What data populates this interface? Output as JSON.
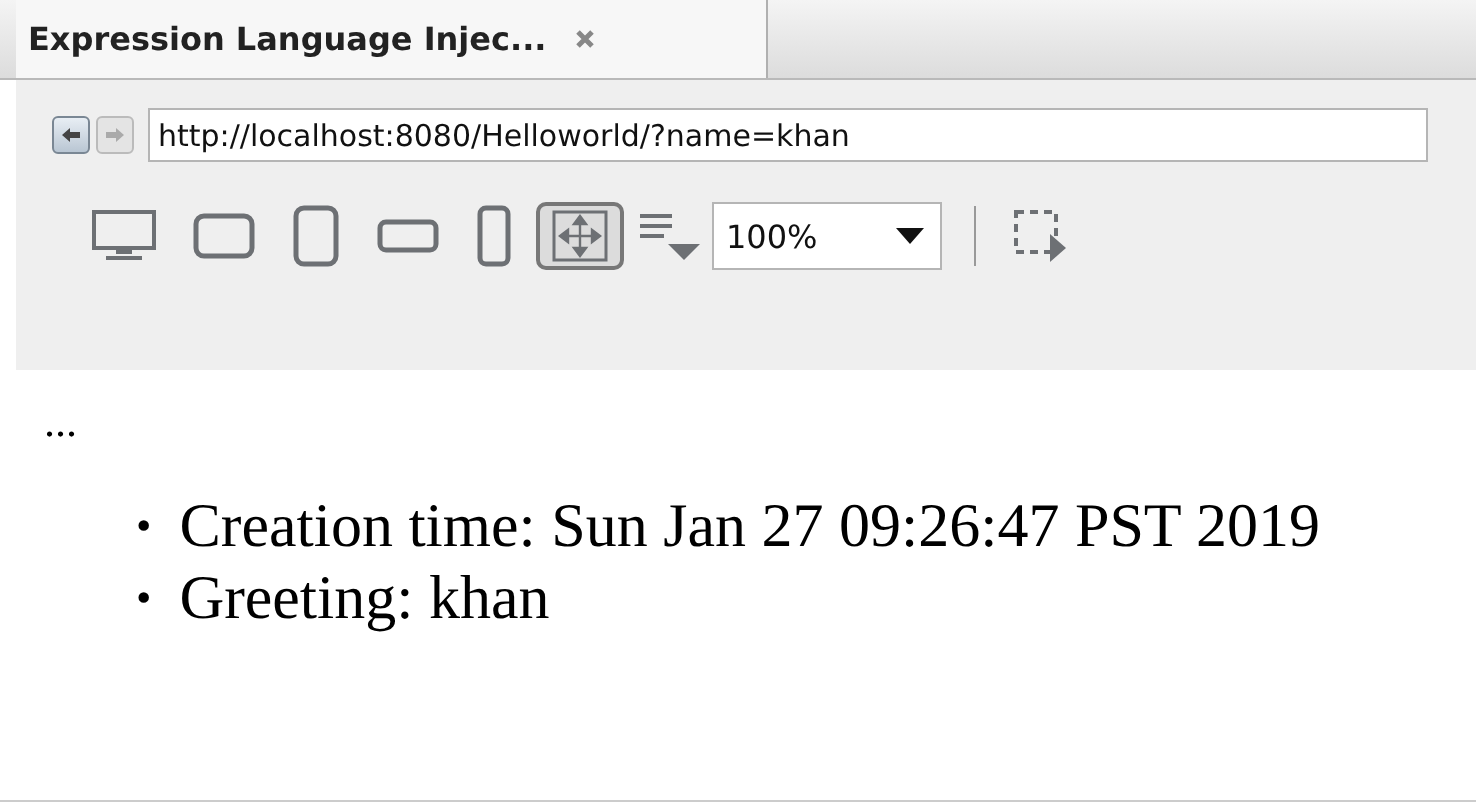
{
  "tab": {
    "title": "Expression Language Injec..."
  },
  "navigation": {
    "buttons": [
      {
        "kind": "back",
        "disabled": false
      },
      {
        "kind": "forward",
        "disabled": true
      }
    ],
    "url": "http://localhost:8080/Helloworld/?name=khan"
  },
  "devices": [
    {
      "kind": "desktop",
      "selected": false
    },
    {
      "kind": "tablet-landscape",
      "selected": false
    },
    {
      "kind": "tablet-portrait",
      "selected": false
    },
    {
      "kind": "phone-landscape",
      "selected": false
    },
    {
      "kind": "phone-portrait",
      "selected": false
    },
    {
      "kind": "fit",
      "selected": true
    }
  ],
  "zoom": {
    "value": "100%"
  },
  "content": {
    "ellipsis": "...",
    "items": [
      {
        "bullet": "•",
        "text": "Creation time: Sun Jan 27 09:26:47 PST 2019"
      },
      {
        "bullet": "•",
        "text": "Greeting: khan"
      }
    ]
  }
}
